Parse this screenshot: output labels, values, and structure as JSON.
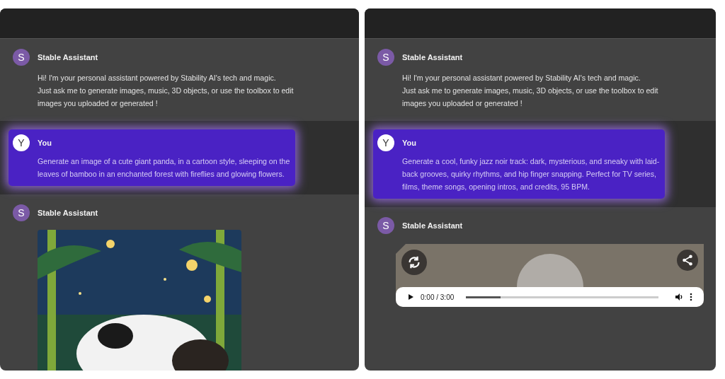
{
  "panels": [
    {
      "messages": [
        {
          "kind": "assistant",
          "avatar": "S",
          "sender": "Stable Assistant",
          "text": "Hi! I'm your personal assistant powered by Stability AI's tech and magic.\nJust ask me to generate images, music, 3D objects, or use the toolbox to edit\nimages you uploaded or generated !"
        },
        {
          "kind": "user",
          "avatar": "Y",
          "sender": "You",
          "text": "Generate an image of a cute giant panda, in a cartoon style, sleeping on the\nleaves of bamboo in an enchanted forest with fireflies and glowing flowers."
        },
        {
          "kind": "assistant",
          "avatar": "S",
          "sender": "Stable Assistant"
        }
      ]
    },
    {
      "messages": [
        {
          "kind": "assistant",
          "avatar": "S",
          "sender": "Stable Assistant",
          "text": "Hi! I'm your personal assistant powered by Stability AI's tech and magic.\nJust ask me to generate images, music, 3D objects, or use the toolbox to edit\nimages you uploaded or generated !"
        },
        {
          "kind": "user",
          "avatar": "Y",
          "sender": "You",
          "text": "Generate a cool, funky jazz noir track: dark, mysterious, and sneaky with laid-\nback grooves, quirky rhythms, and hip finger snapping. Perfect for TV series,\nfilms, theme songs, opening intros, and credits, 95 BPM."
        },
        {
          "kind": "assistant",
          "avatar": "S",
          "sender": "Stable Assistant",
          "attachment": {
            "kind": "audio",
            "time": "0:00 / 3:00",
            "level": 0.18
          }
        }
      ]
    }
  ]
}
